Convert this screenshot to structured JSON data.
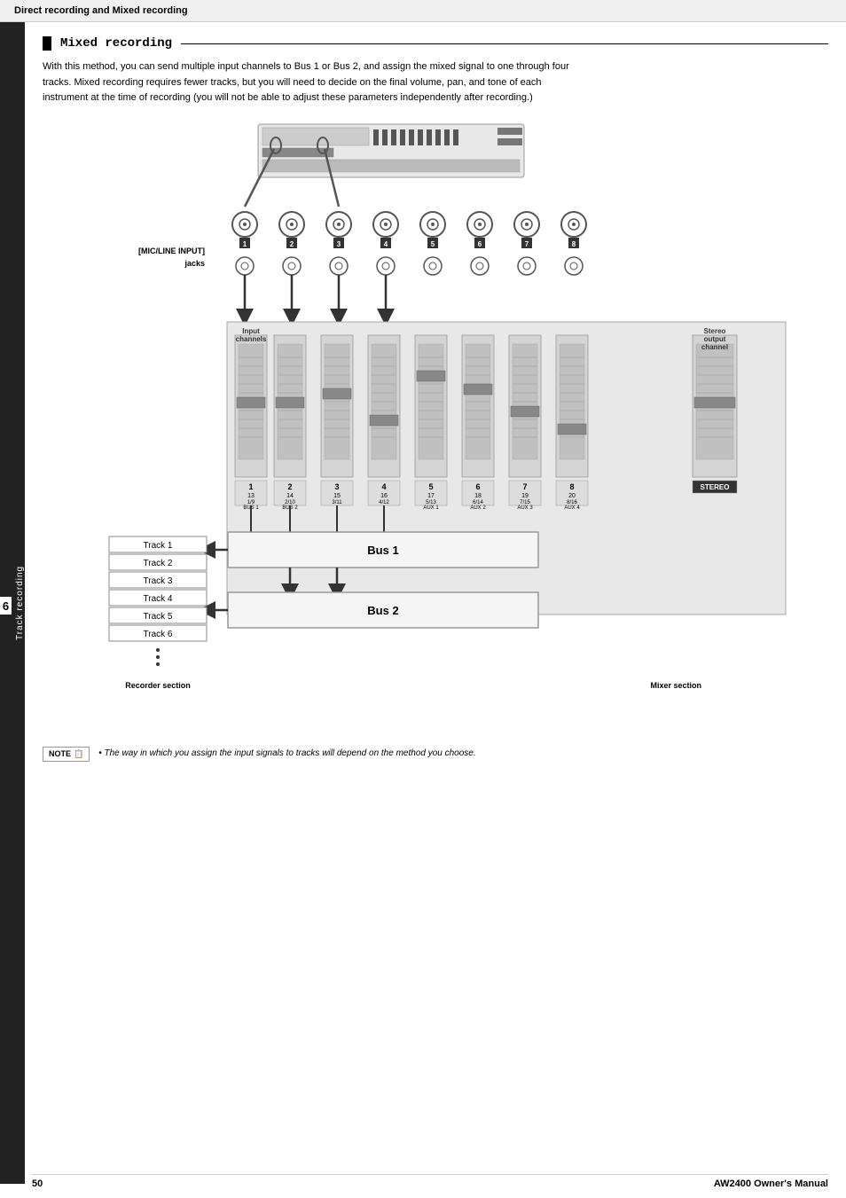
{
  "header": {
    "title": "Direct recording and Mixed recording"
  },
  "side_tab": {
    "number": "6",
    "label": "Track recording"
  },
  "section": {
    "title": "Mixed recording",
    "description": "With this method, you can send multiple input channels to Bus 1 or Bus 2, and assign the mixed signal to one through four tracks. Mixed recording requires fewer tracks, but you will need to decide on the final volume, pan, and tone of each instrument at the time of recording (you will not be able to adjust these parameters independently after recording.)"
  },
  "diagram": {
    "labels": {
      "mic_line_input": "[MIC/LINE INPUT]",
      "jacks": "jacks",
      "input_channels": "Input channels",
      "stereo_output": "Stereo output channel",
      "stereo": "STEREO",
      "bus1": "Bus 1",
      "bus2": "Bus 2",
      "recorder_section": "Recorder section",
      "mixer_section": "Mixer section"
    },
    "tracks": [
      "Track 1",
      "Track 2",
      "Track 3",
      "Track 4",
      "Track 5",
      "Track 6"
    ],
    "channel_numbers": [
      "1",
      "2",
      "3",
      "4",
      "5",
      "6",
      "7",
      "8"
    ],
    "channel_sub": [
      {
        "top": "1",
        "bot": "13",
        "label": "1/9\nBUS 1"
      },
      {
        "top": "2",
        "bot": "14",
        "label": "2/10\nBUS 2"
      },
      {
        "top": "3",
        "bot": "15",
        "label": "3/11"
      },
      {
        "top": "4",
        "bot": "16",
        "label": "4/12"
      },
      {
        "top": "5",
        "bot": "17",
        "label": "5/13\nAUX 1"
      },
      {
        "top": "6",
        "bot": "18",
        "label": "6/14\nAUX 2"
      },
      {
        "top": "7",
        "bot": "19",
        "label": "7/15\nAUX 3"
      },
      {
        "top": "8",
        "bot": "20",
        "label": "8/16\nAUX 4"
      }
    ]
  },
  "note": {
    "label": "NOTE",
    "text": "• The way in which you assign the input signals to tracks will depend on the method you choose."
  },
  "footer": {
    "page_number": "50",
    "manual_title": "AW2400  Owner's Manual"
  }
}
